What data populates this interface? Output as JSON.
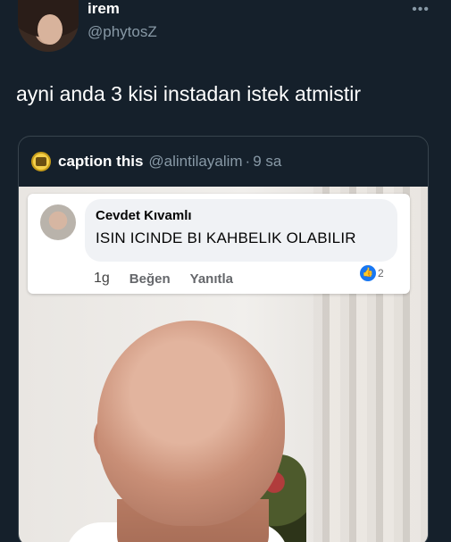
{
  "user": {
    "name": "irem",
    "handle": "@phytosZ"
  },
  "tweet": {
    "text": "ayni anda 3 kisi instadan istek atmistir"
  },
  "quote": {
    "name": "caption this",
    "handle": "@alintilayalim",
    "dot": "·",
    "time": "9 sa",
    "comment": {
      "author": "Cevdet Kıvamlı",
      "text": "ISIN ICINDE BI KAHBELIK OLABILIR",
      "time": "1g",
      "like": "Beğen",
      "reply": "Yanıtla",
      "reaction_count": "2"
    }
  },
  "icons": {
    "more": "more-options-icon",
    "reaction": "thumbs-up-icon"
  },
  "colors": {
    "background": "#15202b",
    "secondary_text": "#8899a6",
    "fb_blue": "#1877f2"
  }
}
